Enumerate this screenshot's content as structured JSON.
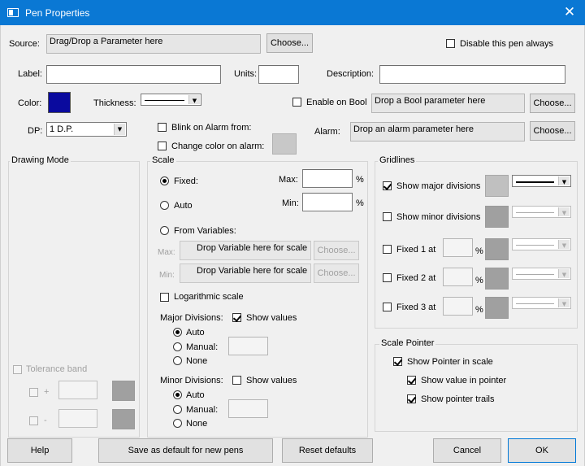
{
  "window": {
    "title": "Pen Properties",
    "close_glyph": "✕"
  },
  "source": {
    "label": "Source:",
    "drop_text": "Drag/Drop a Parameter here",
    "choose": "Choose..."
  },
  "disable_pen": {
    "label": "Disable this pen always",
    "checked": false
  },
  "label_field": {
    "label": "Label:",
    "value": ""
  },
  "units_field": {
    "label": "Units:",
    "value": ""
  },
  "description_field": {
    "label": "Description:",
    "value": ""
  },
  "color": {
    "label": "Color:",
    "value": "#0a0a9e"
  },
  "thickness": {
    "label": "Thickness:"
  },
  "enable_on_bool": {
    "label": "Enable on Bool",
    "drop_text": "Drop a Bool parameter here",
    "choose": "Choose...",
    "checked": false
  },
  "dp": {
    "label": "DP:",
    "value": "1 D.P."
  },
  "blink_alarm": {
    "label": "Blink on Alarm from:",
    "checked": false
  },
  "change_color_alarm": {
    "label": "Change color on alarm:",
    "checked": false
  },
  "alarm": {
    "label": "Alarm:",
    "drop_text": "Drop an alarm parameter here",
    "choose": "Choose..."
  },
  "drawing_mode": {
    "title": "Drawing Mode",
    "tolerance_band": "Tolerance band",
    "plus": "+",
    "minus": "-"
  },
  "scale": {
    "title": "Scale",
    "fixed": "Fixed:",
    "auto": "Auto",
    "from_variables": "From Variables:",
    "max": "Max:",
    "min": "Min:",
    "percent": "%",
    "max_var": "Max:",
    "min_var": "Min:",
    "drop_var": "Drop Variable here for scale",
    "choose": "Choose...",
    "logarithmic": "Logarithmic scale",
    "major_divisions": "Major Divisions:",
    "minor_divisions": "Minor Divisions:",
    "show_values": "Show values",
    "auto_opt": "Auto",
    "manual_opt": "Manual:",
    "none_opt": "None",
    "selected": "fixed",
    "major_selected": "auto",
    "minor_selected": "auto",
    "major_show_values": true,
    "minor_show_values": false
  },
  "gridlines": {
    "title": "Gridlines",
    "show_major": "Show major divisions",
    "show_minor": "Show minor divisions",
    "fixed1": "Fixed 1 at",
    "fixed2": "Fixed 2 at",
    "fixed3": "Fixed 3 at",
    "percent": "%",
    "major_checked": true,
    "major_color": "#c0c0c0",
    "minor_color": "#a0a0a0"
  },
  "scale_pointer": {
    "title": "Scale Pointer",
    "show_pointer": "Show Pointer in scale",
    "show_value": "Show value in pointer",
    "show_trails": "Show pointer trails"
  },
  "buttons": {
    "help": "Help",
    "save_default": "Save as default for new pens",
    "reset": "Reset defaults",
    "cancel": "Cancel",
    "ok": "OK"
  }
}
